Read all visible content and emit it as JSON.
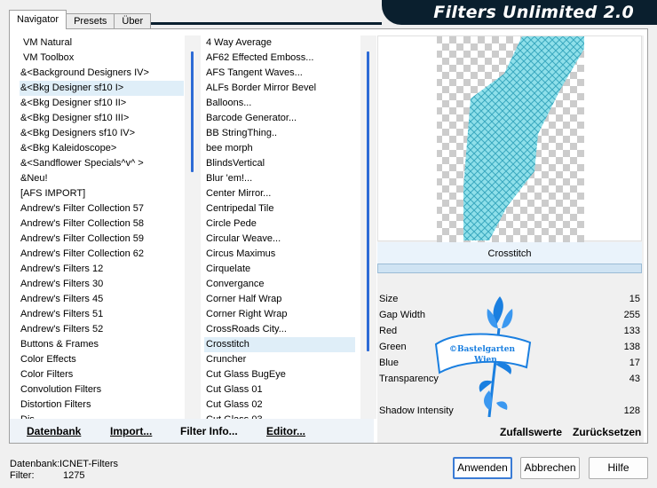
{
  "banner": {
    "title": "Filters Unlimited 2.0"
  },
  "tabs": [
    {
      "label": "Navigator"
    },
    {
      "label": "Presets"
    },
    {
      "label": "Über"
    }
  ],
  "categories": [
    "VM Natural",
    "VM Toolbox",
    "&<Background Designers IV>",
    "&<Bkg Designer sf10 I>",
    "&<Bkg Designer sf10 II>",
    "&<Bkg Designer sf10 III>",
    "&<Bkg Designers sf10 IV>",
    "&<Bkg Kaleidoscope>",
    "&<Sandflower Specials^v^ >",
    "&Neu!",
    "[AFS IMPORT]",
    "Andrew's Filter Collection 57",
    "Andrew's Filter Collection 58",
    "Andrew's Filter Collection 59",
    "Andrew's Filter Collection 62",
    "Andrew's Filters 12",
    "Andrew's Filters 30",
    "Andrew's Filters 45",
    "Andrew's Filters 51",
    "Andrew's Filters 52",
    "Buttons & Frames",
    "Color Effects",
    "Color Filters",
    "Convolution Filters",
    "Distortion Filters",
    "Dis"
  ],
  "categories_selected": 3,
  "filters": [
    "4 Way Average",
    "AF62 Effected Emboss...",
    "AFS Tangent Waves...",
    "ALFs Border Mirror Bevel",
    "Balloons...",
    "Barcode Generator...",
    "BB StringThing..",
    "bee morph",
    "BlindsVertical",
    "Blur 'em!...",
    "Center Mirror...",
    "Centripedal Tile",
    "Circle Pede",
    "Circular Weave...",
    "Circus Maximus",
    "Cirquelate",
    "Convergance",
    "Corner Half Wrap",
    "Corner Right Wrap",
    "CrossRoads City...",
    "Crosstitch",
    "Cruncher",
    "Cut Glass  BugEye",
    "Cut Glass 01",
    "Cut Glass 02",
    "Cut Glass 03"
  ],
  "filters_selected": 20,
  "actions": {
    "datenbank": "Datenbank",
    "import": "Import...",
    "filter_info": "Filter Info...",
    "editor": "Editor..."
  },
  "preview": {
    "filter_name": "Crosstitch",
    "thumbnail_color": "#8fe0ea"
  },
  "params": [
    {
      "label": "Size",
      "value": "15"
    },
    {
      "label": "Gap Width",
      "value": "255"
    },
    {
      "label": "Red",
      "value": "133"
    },
    {
      "label": "Green",
      "value": "138"
    },
    {
      "label": "Blue",
      "value": "17"
    },
    {
      "label": "Transparency",
      "value": "43"
    },
    {
      "label": "",
      "value": ""
    },
    {
      "label": "Shadow Intensity",
      "value": "128"
    }
  ],
  "right_actions": {
    "random": "Zufallswerte",
    "reset": "Zurücksetzen"
  },
  "watermark": {
    "text": "©Bastelgarten Wien"
  },
  "status": {
    "db_label": "Datenbank:",
    "db_value": "ICNET-Filters",
    "filter_label": "Filter:",
    "filter_value": "1275"
  },
  "buttons": {
    "apply": "Anwenden",
    "cancel": "Abbrechen",
    "help": "Hilfe"
  },
  "colors": {
    "banner": "#0a1f2e",
    "accent": "#2d6bd6",
    "selection": "#dfeef8"
  }
}
